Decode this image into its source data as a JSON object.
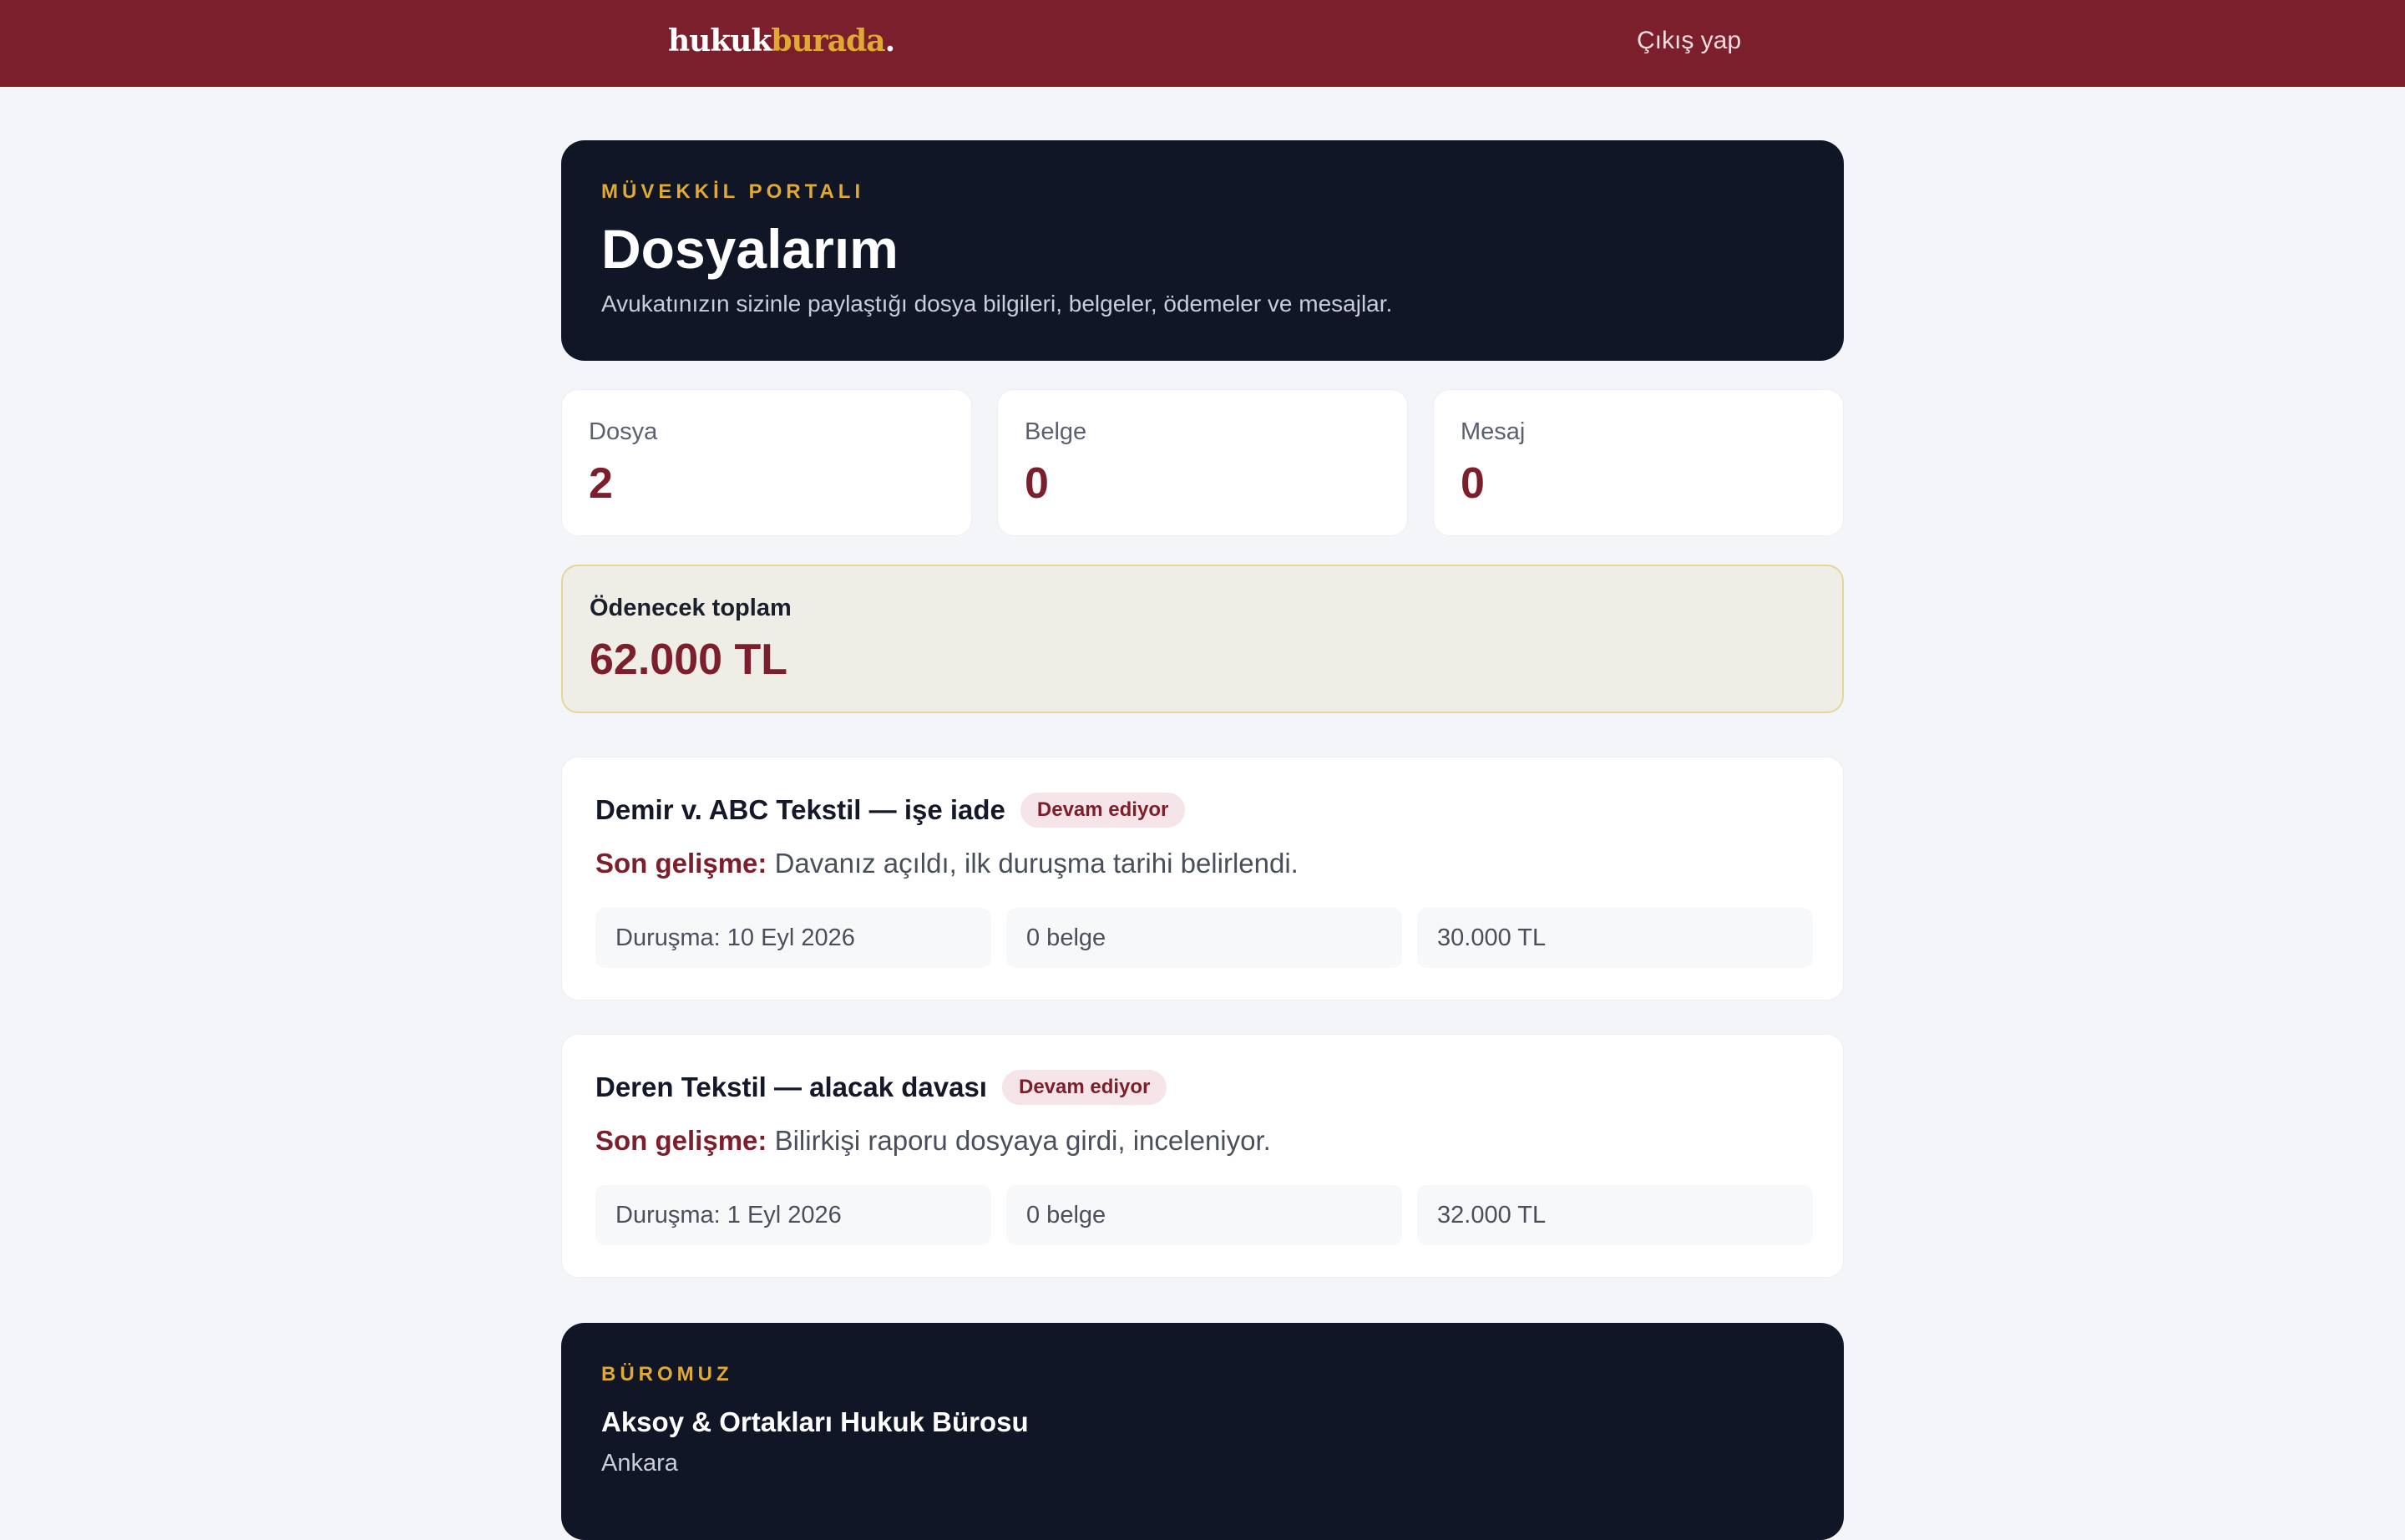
{
  "header": {
    "logo_part1": "hukuk",
    "logo_part2": "burada",
    "logo_dot": ".",
    "logout_label": "Çıkış yap"
  },
  "hero": {
    "eyebrow": "MÜVEKKİL PORTALI",
    "title": "Dosyalarım",
    "subtitle": "Avukatınızın sizinle paylaştığı dosya bilgileri, belgeler, ödemeler ve mesajlar."
  },
  "stats": [
    {
      "label": "Dosya",
      "value": "2"
    },
    {
      "label": "Belge",
      "value": "0"
    },
    {
      "label": "Mesaj",
      "value": "0"
    }
  ],
  "due": {
    "label": "Ödenecek toplam",
    "value": "62.000 TL"
  },
  "cases": [
    {
      "title": "Demir v. ABC Tekstil — işe iade",
      "status": "Devam ediyor",
      "update_label": "Son gelişme:",
      "update_text": "Davanız açıldı, ilk duruşma tarihi belirlendi.",
      "hearing": "Duruşma: 10 Eyl 2026",
      "documents": "0 belge",
      "amount": "30.000 TL"
    },
    {
      "title": "Deren Tekstil — alacak davası",
      "status": "Devam ediyor",
      "update_label": "Son gelişme:",
      "update_text": "Bilirkişi raporu dosyaya girdi, inceleniyor.",
      "hearing": "Duruşma: 1 Eyl 2026",
      "documents": "0 belge",
      "amount": "32.000 TL"
    }
  ],
  "office": {
    "eyebrow": "BÜROMUZ",
    "name": "Aksoy & Ortakları Hukuk Bürosu",
    "city": "Ankara"
  },
  "colors": {
    "brand": "#7c1f2c",
    "accent": "#e0aa32",
    "dark": "#111627"
  }
}
